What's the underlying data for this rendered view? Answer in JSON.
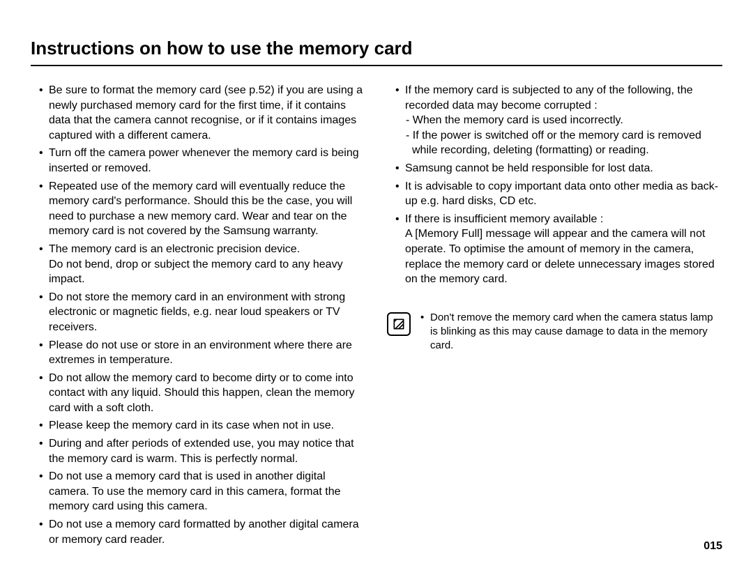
{
  "title": "Instructions on how to use the memory card",
  "pageNumber": "015",
  "left": {
    "items": [
      {
        "text": "Be sure to format the memory card (see p.52) if you are using a newly purchased memory card for the first time, if it contains data that the camera cannot recognise, or if it contains images captured with a different camera."
      },
      {
        "text": "Turn off the camera power whenever the memory card is being inserted or removed."
      },
      {
        "text": "Repeated use of the memory card will eventually reduce the memory card's performance. Should this be the case, you will need to purchase a new memory card. Wear and tear on the memory card is not covered by the Samsung warranty."
      },
      {
        "text": "The memory card is an electronic precision device.",
        "sub": "Do not bend, drop or subject the memory card to any heavy impact."
      },
      {
        "text": "Do not store the memory card in an environment with strong electronic or magnetic fields, e.g. near loud speakers or TV receivers."
      },
      {
        "text": "Please do not use or store in an environment where there are extremes in temperature."
      },
      {
        "text": "Do not allow the memory card to become dirty or to come into contact with any liquid. Should this happen, clean the memory card with a soft cloth."
      },
      {
        "text": "Please keep the memory card in its case when not in use."
      },
      {
        "text": "During and after periods of extended use, you may notice that the memory card is warm. This is perfectly normal."
      },
      {
        "text": "Do not use a memory card that is used in another digital camera. To use the memory card in this camera, format the memory card using this camera."
      },
      {
        "text": "Do not use a memory card formatted by another digital camera or memory card reader."
      }
    ]
  },
  "right": {
    "items": [
      {
        "text": "If the memory card is subjected to any of the following, the recorded data may become corrupted :",
        "dashes": [
          "- When the memory card is used incorrectly.",
          "- If the power is switched off or the memory card is removed while recording, deleting (formatting) or reading."
        ]
      },
      {
        "text": "Samsung cannot be held responsible for lost data."
      },
      {
        "text": "It is advisable to copy important data onto other media as back-up e.g. hard disks, CD etc."
      },
      {
        "text": "If there is insufficient memory available :",
        "sub": "A [Memory Full] message will appear and the camera will not operate. To optimise the amount of memory in the camera, replace the memory card or delete unnecessary images stored on the memory card."
      }
    ]
  },
  "note": {
    "iconName": "note-icon",
    "text": "Don't remove the memory card when the camera status lamp is blinking as this may cause damage to data in the memory card."
  }
}
